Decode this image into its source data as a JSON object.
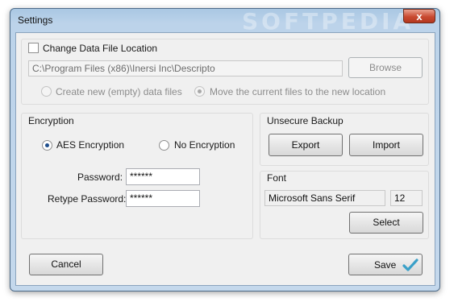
{
  "window": {
    "title": "Settings",
    "watermark": "SOFTPEDIA",
    "close_glyph": "x"
  },
  "data_location": {
    "checkbox_label": "Change Data File Location",
    "checked": false,
    "path_value": "C:\\Program Files (x86)\\Inersi Inc\\Descripto",
    "browse_label": "Browse",
    "option_new_label": "Create new (empty) data files",
    "option_move_label": "Move the current files to the new location",
    "selected_option": "move"
  },
  "encryption": {
    "group_label": "Encryption",
    "aes_label": "AES Encryption",
    "none_label": "No Encryption",
    "selected": "aes",
    "password_label": "Password:",
    "password_value": "******",
    "retype_label": "Retype Password:",
    "retype_value": "******"
  },
  "backup": {
    "group_label": "Unsecure Backup",
    "export_label": "Export",
    "import_label": "Import"
  },
  "font": {
    "group_label": "Font",
    "name_value": "Microsoft Sans Serif",
    "size_value": "12",
    "select_label": "Select"
  },
  "footer": {
    "cancel_label": "Cancel",
    "save_label": "Save",
    "save_icon": "checkmark-icon",
    "save_icon_color": "#3aa0c8"
  }
}
